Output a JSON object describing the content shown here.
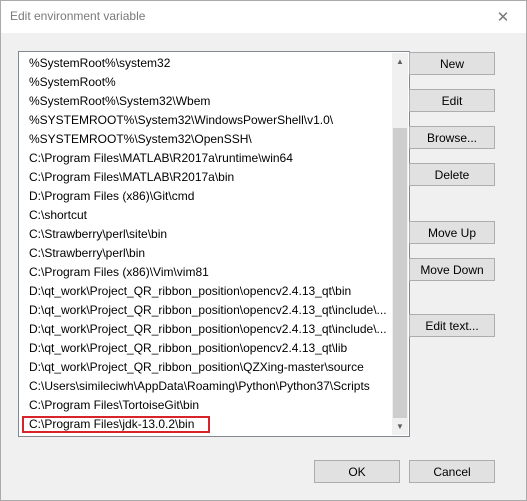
{
  "window": {
    "title": "Edit environment variable",
    "close_glyph": "✕"
  },
  "path_list": {
    "items": [
      "%SystemRoot%\\system32",
      "%SystemRoot%",
      "%SystemRoot%\\System32\\Wbem",
      "%SYSTEMROOT%\\System32\\WindowsPowerShell\\v1.0\\",
      "%SYSTEMROOT%\\System32\\OpenSSH\\",
      "C:\\Program Files\\MATLAB\\R2017a\\runtime\\win64",
      "C:\\Program Files\\MATLAB\\R2017a\\bin",
      "D:\\Program Files (x86)\\Git\\cmd",
      "C:\\shortcut",
      "C:\\Strawberry\\perl\\site\\bin",
      "C:\\Strawberry\\perl\\bin",
      "C:\\Program Files (x86)\\Vim\\vim81",
      "D:\\qt_work\\Project_QR_ribbon_position\\opencv2.4.13_qt\\bin",
      "D:\\qt_work\\Project_QR_ribbon_position\\opencv2.4.13_qt\\include\\...",
      "D:\\qt_work\\Project_QR_ribbon_position\\opencv2.4.13_qt\\include\\...",
      "D:\\qt_work\\Project_QR_ribbon_position\\opencv2.4.13_qt\\lib",
      "D:\\qt_work\\Project_QR_ribbon_position\\QZXing-master\\source",
      "C:\\Users\\simileciwh\\AppData\\Roaming\\Python\\Python37\\Scripts",
      "C:\\Program Files\\TortoiseGit\\bin",
      "C:\\Program Files\\jdk-13.0.2\\bin"
    ],
    "selected_index": 19,
    "highlight_color": "#d9232a"
  },
  "scrollbar": {
    "up_glyph": "▲",
    "down_glyph": "▼"
  },
  "buttons": {
    "new": "New",
    "edit": "Edit",
    "browse": "Browse...",
    "delete": "Delete",
    "move_up": "Move Up",
    "move_down": "Move Down",
    "edit_text": "Edit text...",
    "ok": "OK",
    "cancel": "Cancel"
  }
}
